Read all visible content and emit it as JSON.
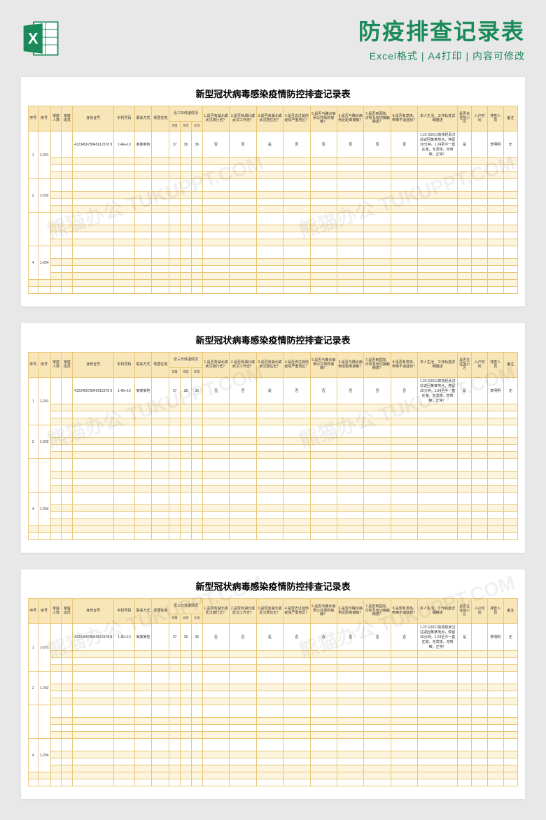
{
  "header": {
    "title": "防疫排查记录表",
    "subtitle": "Excel格式 | A4打印 | 内容可修改",
    "icon_name": "excel-icon",
    "icon_letter": "X"
  },
  "sheet": {
    "title": "新型冠状病毒感染疫情防控排查记录表",
    "columns": {
      "seq": "序号",
      "room": "房号",
      "pop": "家庭人数",
      "rel": "家庭成员",
      "idno": "身份证号",
      "phone": "手机号码",
      "contact": "联系方式",
      "addr": "现居住地",
      "temp_group": "近三日体温情况",
      "temp_d1": "X日",
      "temp_d2": "X日",
      "temp_d3": "X日",
      "q1": "1.是否有湖北或 武汉旅行史？",
      "q2": "2.是否有湖北或 武汉工作史？",
      "q3": "3.是否有湖北或 武汉居住史？",
      "q4": "4.是否去过其他 疫情严重地区？",
      "q5": "5.是否与确诊病 例公共场所接触？",
      "q6": "6.是否与确诊病 例近距离接触？",
      "q7": "7.是否到医院、诊所及有切接触病患？",
      "q8": "8.是否有发热、咳嗽不适症状？",
      "track": "本人生活、工作轨迹详细描述",
      "home": "是否在住所小区",
      "entry": "入户时间",
      "rec": "排查人员",
      "note": "备注"
    },
    "rows": [
      {
        "seq": "1",
        "room": "1-201",
        "pop": "",
        "rel": "",
        "idno": "412345678945612378 9",
        "phone": "1.4E+10",
        "contact": "某某某地",
        "addr": "",
        "t1": "37",
        "t2": "36",
        "t3": "36",
        "a1": "否",
        "a2": "否",
        "a3": "是",
        "a4": "否",
        "a5": "否",
        "a6": "否",
        "a7": "否",
        "a8": "否",
        "track": "1.23 G3011高铁经武汉站返回某某地点，停留30分钟。1.24至今一直在家，无发热，无咳嗽，正常！",
        "home": "是",
        "entry": "",
        "rec": "李明明",
        "note": "无"
      },
      {
        "seq": "2",
        "room": "1-202"
      },
      {
        "seq": "",
        "room": ""
      },
      {
        "seq": "4",
        "room": "1-204"
      }
    ]
  },
  "watermark": "熊猫办公 TUKUPPT.COM"
}
